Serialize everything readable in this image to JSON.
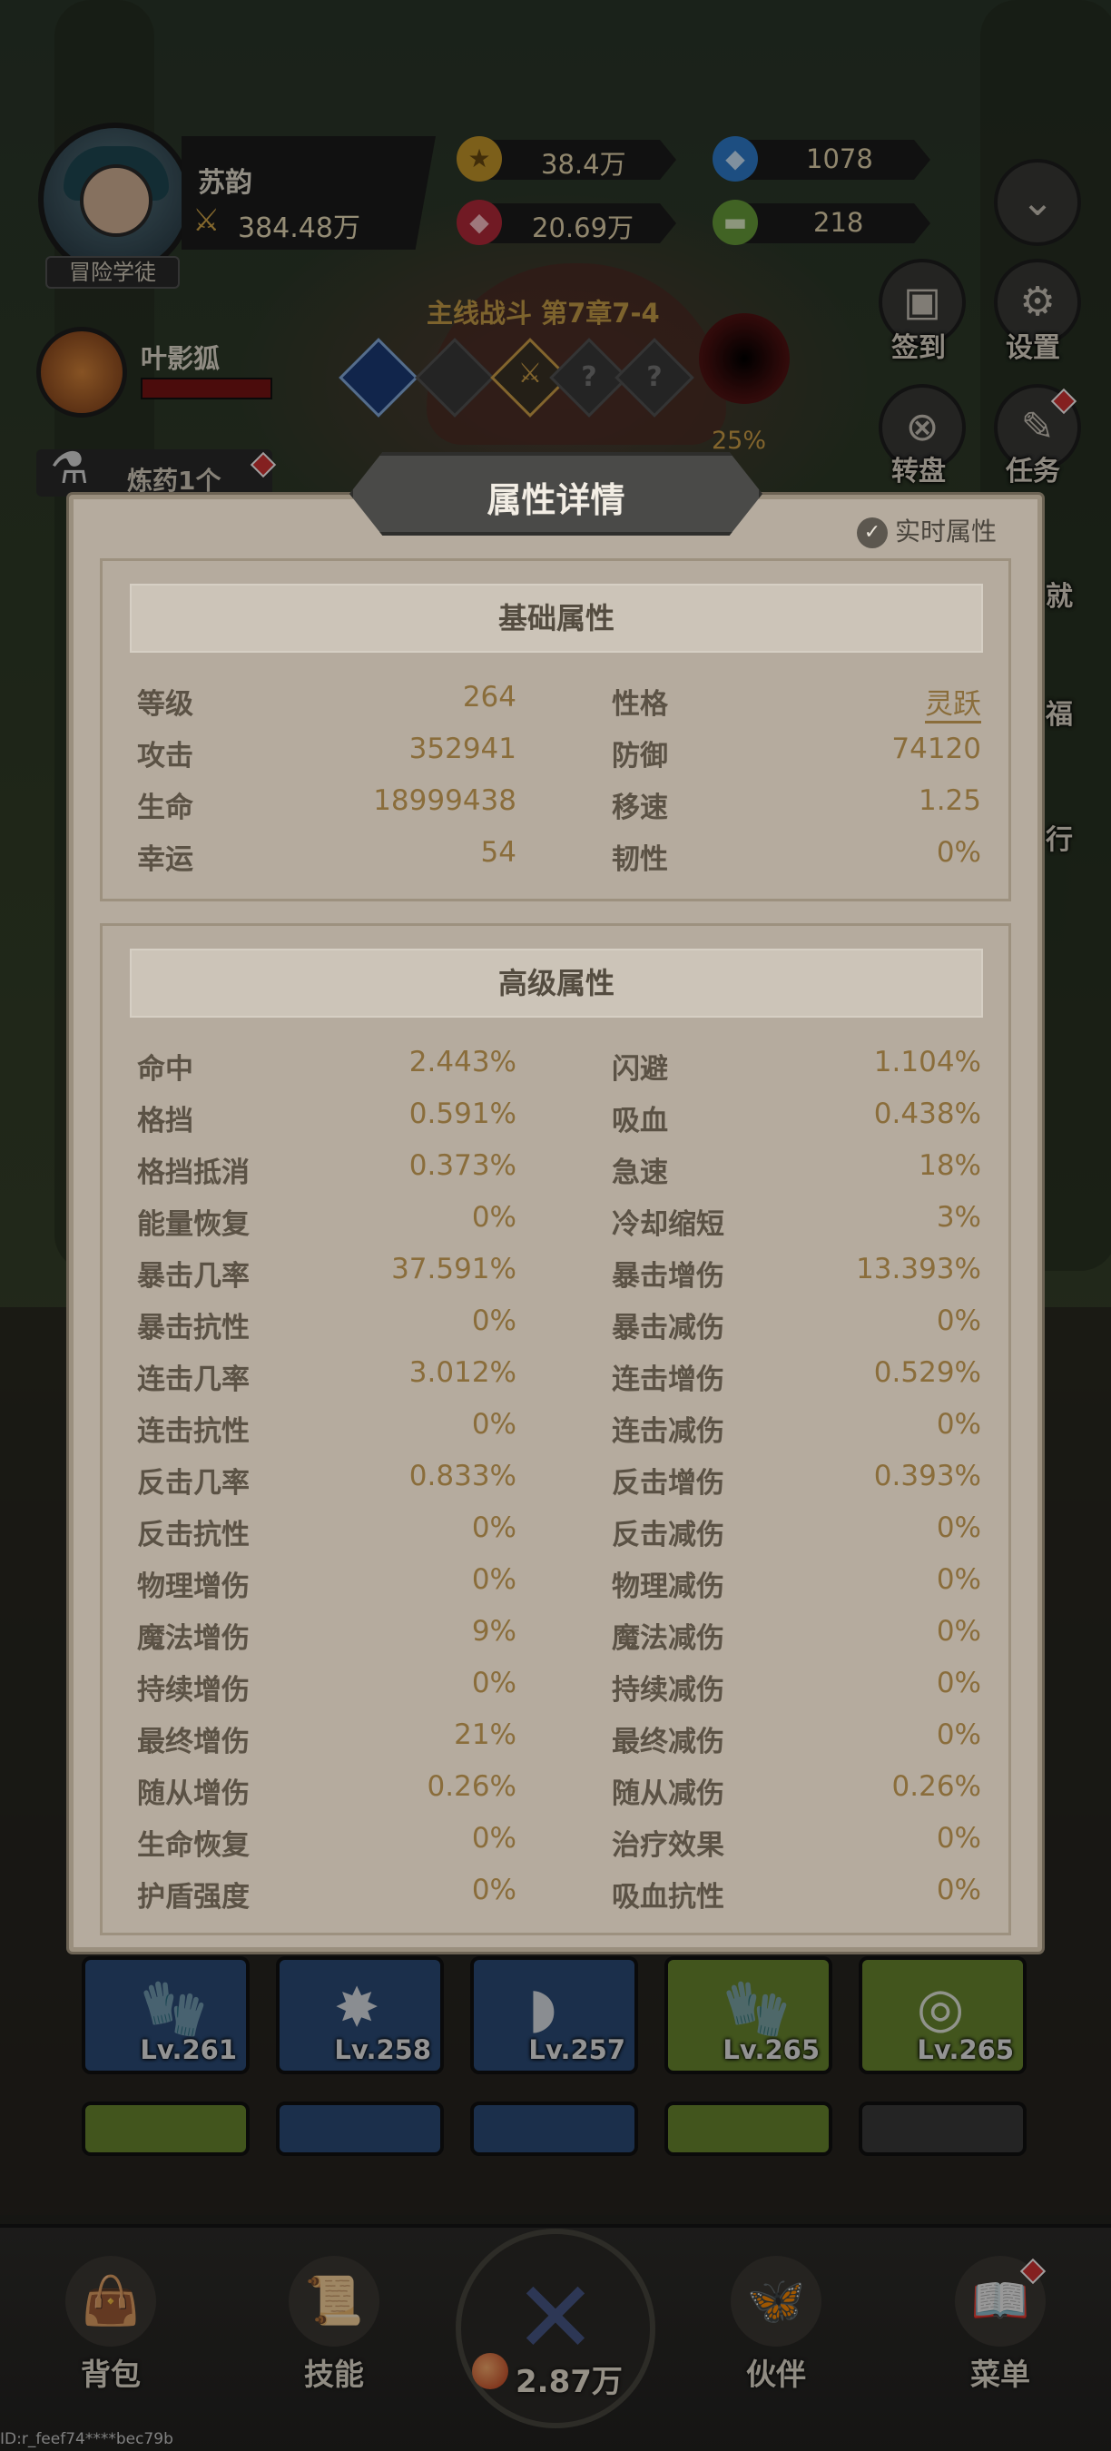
{
  "player": {
    "name": "苏韵",
    "power": "384.48万",
    "title": "冒险学徒"
  },
  "resources": {
    "gold": "38.4万",
    "blue_gem": "1078",
    "red_gem": "20.69万",
    "ticket": "218"
  },
  "stage": {
    "label": "主线战斗 第7章7-4",
    "boss_progress": "25%",
    "unknown_marks": [
      "?",
      "?"
    ]
  },
  "pet": {
    "name": "叶影狐"
  },
  "potion": {
    "label": "炼药1个"
  },
  "side_buttons": {
    "checkin": "签到",
    "settings": "设置",
    "wheel": "转盘",
    "tasks": "任务",
    "partial_1": "就",
    "partial_2": "福",
    "partial_3": "行"
  },
  "modal": {
    "title": "属性详情",
    "realtime_label": "实时属性",
    "basic": {
      "heading": "基础属性",
      "rows": [
        {
          "l_label": "等级",
          "l_val": "264",
          "r_label": "性格",
          "r_val": "灵跃"
        },
        {
          "l_label": "攻击",
          "l_val": "352941",
          "r_label": "防御",
          "r_val": "74120"
        },
        {
          "l_label": "生命",
          "l_val": "18999438",
          "r_label": "移速",
          "r_val": "1.25"
        },
        {
          "l_label": "幸运",
          "l_val": "54",
          "r_label": "韧性",
          "r_val": "0%"
        }
      ]
    },
    "advanced": {
      "heading": "高级属性",
      "rows": [
        {
          "l_label": "命中",
          "l_val": "2.443%",
          "r_label": "闪避",
          "r_val": "1.104%"
        },
        {
          "l_label": "格挡",
          "l_val": "0.591%",
          "r_label": "吸血",
          "r_val": "0.438%"
        },
        {
          "l_label": "格挡抵消",
          "l_val": "0.373%",
          "r_label": "急速",
          "r_val": "18%"
        },
        {
          "l_label": "能量恢复",
          "l_val": "0%",
          "r_label": "冷却缩短",
          "r_val": "3%"
        },
        {
          "l_label": "暴击几率",
          "l_val": "37.591%",
          "r_label": "暴击增伤",
          "r_val": "13.393%"
        },
        {
          "l_label": "暴击抗性",
          "l_val": "0%",
          "r_label": "暴击减伤",
          "r_val": "0%"
        },
        {
          "l_label": "连击几率",
          "l_val": "3.012%",
          "r_label": "连击增伤",
          "r_val": "0.529%"
        },
        {
          "l_label": "连击抗性",
          "l_val": "0%",
          "r_label": "连击减伤",
          "r_val": "0%"
        },
        {
          "l_label": "反击几率",
          "l_val": "0.833%",
          "r_label": "反击增伤",
          "r_val": "0.393%"
        },
        {
          "l_label": "反击抗性",
          "l_val": "0%",
          "r_label": "反击减伤",
          "r_val": "0%"
        },
        {
          "l_label": "物理增伤",
          "l_val": "0%",
          "r_label": "物理减伤",
          "r_val": "0%"
        },
        {
          "l_label": "魔法增伤",
          "l_val": "9%",
          "r_label": "魔法减伤",
          "r_val": "0%"
        },
        {
          "l_label": "持续增伤",
          "l_val": "0%",
          "r_label": "持续减伤",
          "r_val": "0%"
        },
        {
          "l_label": "最终增伤",
          "l_val": "21%",
          "r_label": "最终减伤",
          "r_val": "0%"
        },
        {
          "l_label": "随从增伤",
          "l_val": "0.26%",
          "r_label": "随从减伤",
          "r_val": "0.26%"
        },
        {
          "l_label": "生命恢复",
          "l_val": "0%",
          "r_label": "治疗效果",
          "r_val": "0%"
        },
        {
          "l_label": "护盾强度",
          "l_val": "0%",
          "r_label": "吸血抗性",
          "r_val": "0%"
        }
      ]
    }
  },
  "equipment": [
    {
      "level": "Lv.261",
      "color": "blue"
    },
    {
      "level": "Lv.258",
      "color": "blue"
    },
    {
      "level": "Lv.257",
      "color": "blue"
    },
    {
      "level": "Lv.265",
      "color": "green"
    },
    {
      "level": "Lv.265",
      "color": "green"
    }
  ],
  "nav": {
    "bag": "背包",
    "skills": "技能",
    "battle_power": "2.87万",
    "partner": "伙伴",
    "menu": "菜单"
  },
  "footer": {
    "id_text": "ID:r_feef74****bec79b"
  }
}
